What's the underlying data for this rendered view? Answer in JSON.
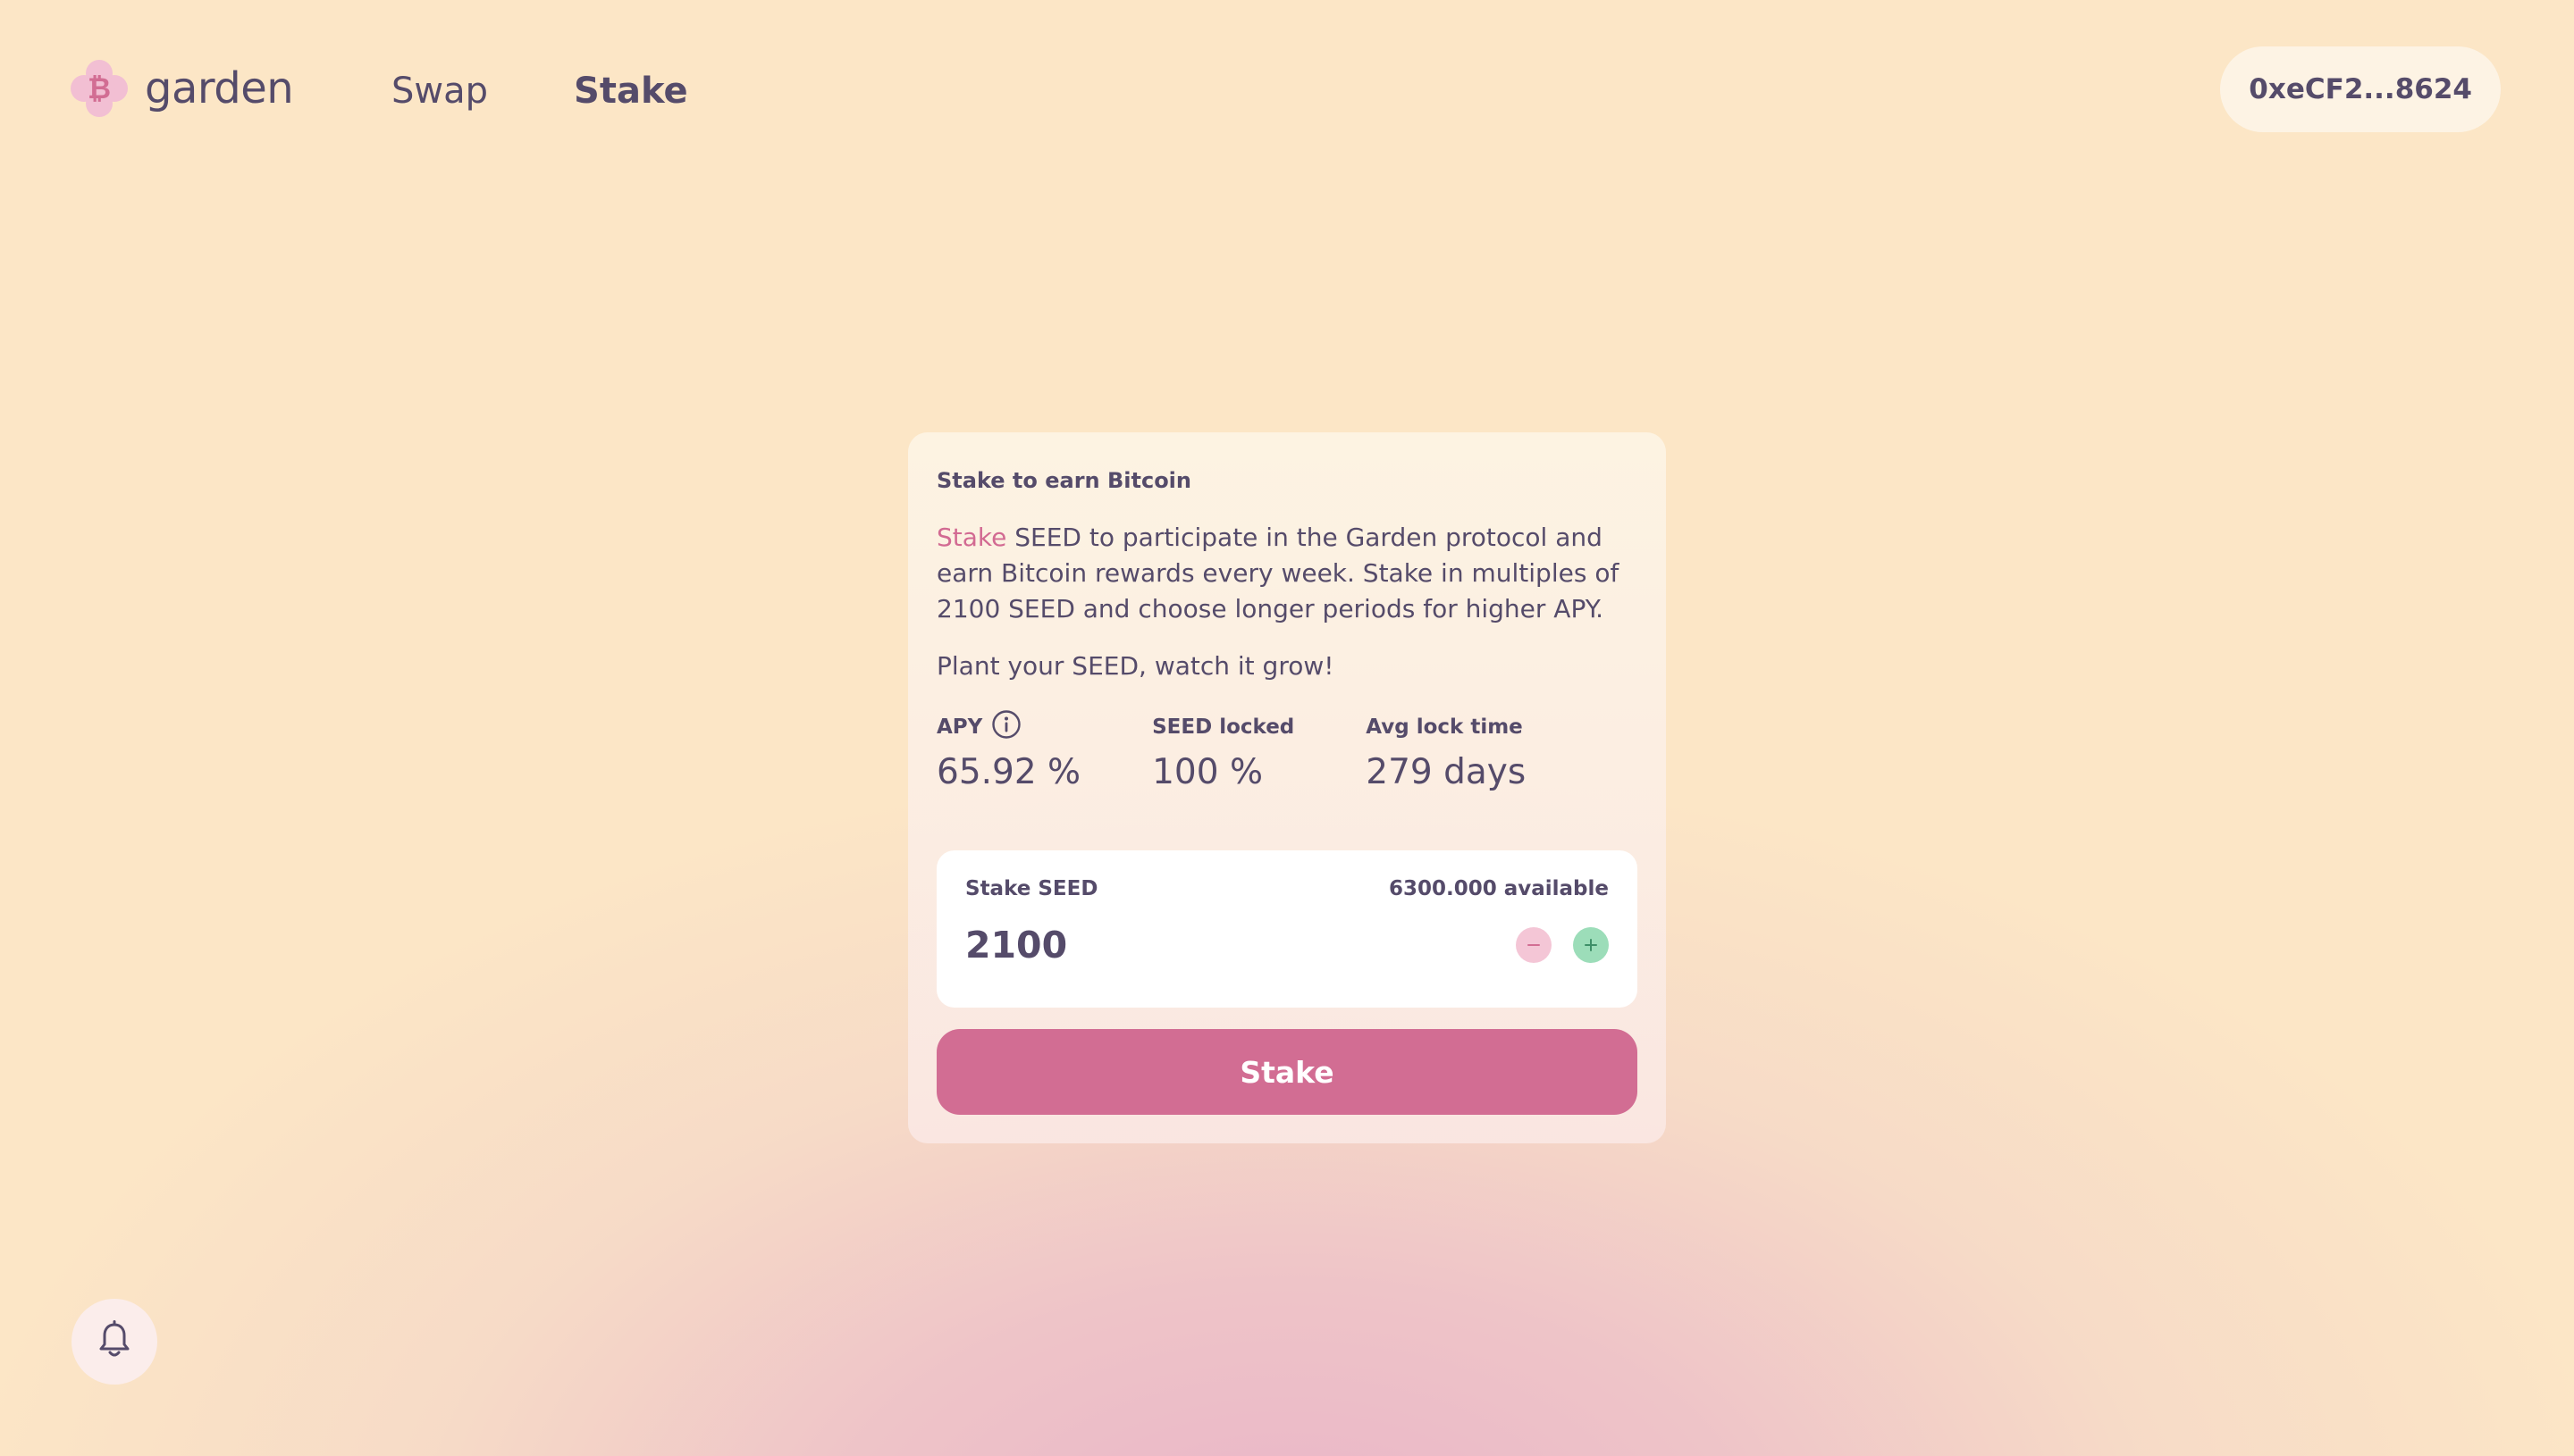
{
  "header": {
    "logo_text": "garden",
    "nav": [
      {
        "label": "Swap",
        "active": false
      },
      {
        "label": "Stake",
        "active": true
      }
    ],
    "wallet_address": "0xeCF2...8624"
  },
  "card": {
    "title": "Stake to earn Bitcoin",
    "desc_accent": "Stake",
    "desc_rest": " SEED to participate in the Garden protocol and earn Bitcoin rewards every week. Stake in multiples of 2100 SEED and choose longer periods for higher APY.",
    "tagline": "Plant your SEED, watch it grow!",
    "stats": [
      {
        "label": "APY",
        "value": "65.92 %"
      },
      {
        "label": "SEED locked",
        "value": "100 %"
      },
      {
        "label": "Avg lock time",
        "value": "279 days"
      }
    ],
    "input": {
      "label": "Stake SEED",
      "available": "6300.000 available",
      "amount": "2100"
    },
    "button_label": "Stake"
  },
  "icons": {
    "logo": "bitcoin-flower-icon",
    "info": "info-icon",
    "minus": "minus-icon",
    "plus": "plus-icon",
    "bell": "bell-icon"
  },
  "colors": {
    "accent": "#D26D93",
    "text": "#554B6A",
    "plus": "#9CDDB9",
    "minus": "#F4C6D6"
  }
}
